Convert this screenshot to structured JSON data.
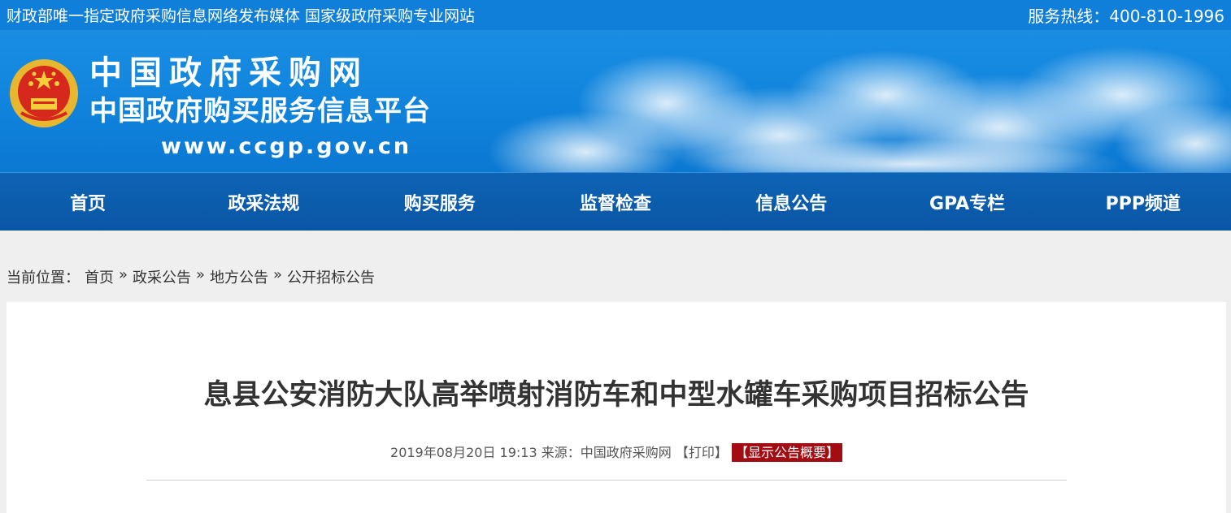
{
  "topbar": {
    "tagline": "财政部唯一指定政府采购信息网络发布媒体 国家级政府采购专业网站",
    "hotline": "服务热线：400-810-1996"
  },
  "banner": {
    "title_cn": "中国政府采购网",
    "subtitle_cn": "中国政府购买服务信息平台",
    "url": "www.ccgp.gov.cn"
  },
  "nav": {
    "items": [
      "首页",
      "政采法规",
      "购买服务",
      "监督检查",
      "信息公告",
      "GPA专栏",
      "PPP频道"
    ]
  },
  "breadcrumb": {
    "label": "当前位置：",
    "items": [
      "首页",
      "政采公告",
      "地方公告",
      "公开招标公告"
    ],
    "sep": "»"
  },
  "article": {
    "title": "息县公安消防大队高举喷射消防车和中型水罐车采购项目招标公告",
    "datetime": "2019年08月20日 19:13",
    "source": "来源：中国政府采购网",
    "print": "【打印】",
    "summary": "【显示公告概要】"
  },
  "colors": {
    "topbar": "#0f7fd9",
    "nav": "#0a56a5",
    "accent_red": "#a10d12"
  }
}
